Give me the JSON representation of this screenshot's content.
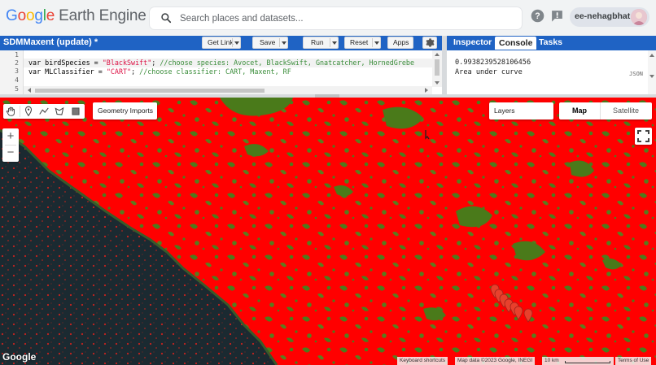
{
  "header": {
    "logo_parts": [
      "G",
      "o",
      "o",
      "g",
      "l",
      "e"
    ],
    "logo_rest": "Earth Engine",
    "search_placeholder": "Search places and datasets...",
    "user_name": "ee-nehagbhat"
  },
  "editor": {
    "title": "SDMMaxent (update) *",
    "buttons": {
      "get_link": "Get Link",
      "save": "Save",
      "run": "Run",
      "reset": "Reset",
      "apps": "Apps"
    },
    "line_numbers": [
      "1",
      "2",
      "3",
      "4",
      "5"
    ],
    "lines": [
      {
        "pre": "var birdSpecies = ",
        "str": "\"BlackSwift\"",
        "post": "; ",
        "comment": "//choose species: Avocet, BlackSwift, Gnatcatcher, HornedGrebe"
      },
      {
        "pre": "var MLClassifier = ",
        "str": "\"CART\"",
        "post": "; ",
        "comment": "//choose classifier: CART, Maxent, RF"
      }
    ]
  },
  "right_panel": {
    "tabs": [
      "Inspector",
      "Console",
      "Tasks"
    ],
    "active_tab": "Console",
    "console_lines": [
      "0.9938239528106456",
      "Area under curve"
    ],
    "json_label": "JSON"
  },
  "map": {
    "geometry_imports": "Geometry Imports",
    "layers": "Layers",
    "map_types": [
      "Map",
      "Satellite"
    ],
    "selected_map_type": "Map",
    "zoom_in": "+",
    "zoom_out": "−",
    "logo_text": "Google",
    "attribution": {
      "shortcuts": "Keyboard shortcuts",
      "map_data": "Map data ©2023 Google, INEGI",
      "scale": "10 km",
      "terms": "Terms of Use"
    },
    "colors": {
      "presence": "#ff0000",
      "absence": "#4a7a1a",
      "water": "#1c2b33"
    }
  }
}
